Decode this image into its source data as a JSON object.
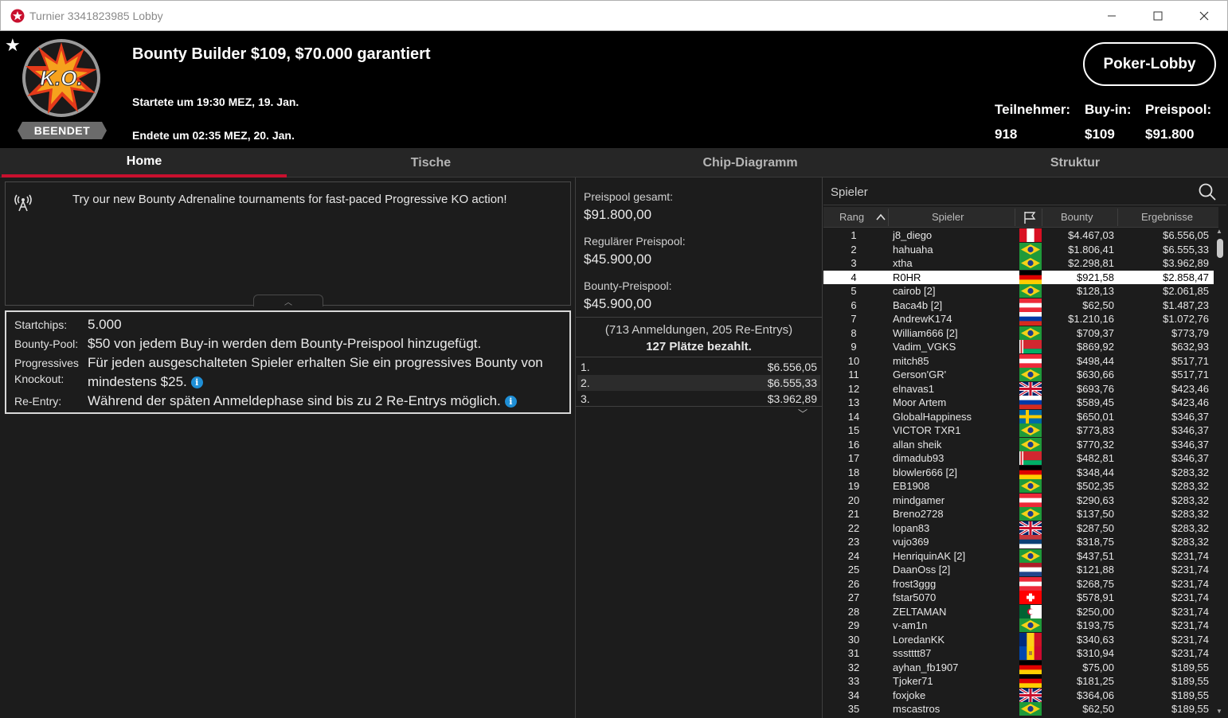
{
  "window": {
    "title": "Turnier 3341823985 Lobby",
    "controls": [
      "minimize-icon",
      "maximize-icon",
      "close-icon"
    ]
  },
  "header": {
    "tournament_name": "Bounty Builder $109, $70.000 garantiert",
    "start": "Startete um 19:30 MEZ, 19. Jan.",
    "end": "Endete um 02:35 MEZ, 20. Jan.",
    "status_badge": "BEENDET",
    "logo_text": "K.O.",
    "lobby_button": "Poker-Lobby",
    "stats": {
      "participants_label": "Teilnehmer:",
      "participants": "918",
      "buyin_label": "Buy-in:",
      "buyin": "$109",
      "prizepool_label": "Preispool:",
      "prizepool": "$91.800"
    }
  },
  "tabs": [
    {
      "label": "Home",
      "active": true
    },
    {
      "label": "Tische",
      "active": false
    },
    {
      "label": "Chip-Diagramm",
      "active": false
    },
    {
      "label": "Struktur",
      "active": false
    }
  ],
  "news": {
    "text": "Try our new Bounty Adrenaline tournaments for fast-paced Progressive KO action!"
  },
  "info": {
    "startchips_label": "Startchips:",
    "startchips": "5.000",
    "bountypool_label": "Bounty-Pool:",
    "bountypool": "$50 von jedem Buy-in werden dem Bounty-Preispool hinzugefügt.",
    "pko_label_1": "Progressives",
    "pko_label_2": "Knockout:",
    "pko_line1": "Für jeden ausgeschalteten Spieler erhalten Sie ein progressives Bounty von",
    "pko_line2": "mindestens $25.",
    "reentry_label": "Re-Entry:",
    "reentry": "Während der späten Anmeldephase sind bis zu 2 Re-Entrys möglich."
  },
  "prize": {
    "total_label": "Preispool gesamt:",
    "total": "$91.800,00",
    "regular_label": "Regulärer Preispool:",
    "regular": "$45.900,00",
    "bounty_label": "Bounty-Preispool:",
    "bounty": "$45.900,00",
    "registrations": "(713 Anmeldungen, 205 Re-Entrys)",
    "paid": "127 Plätze bezahlt.",
    "payouts": [
      {
        "place": "1.",
        "amount": "$6.556,05"
      },
      {
        "place": "2.",
        "amount": "$6.555,33"
      },
      {
        "place": "3.",
        "amount": "$3.962,89"
      }
    ]
  },
  "players": {
    "search_label": "Spieler",
    "columns": {
      "rank": "Rang",
      "player": "Spieler",
      "bounty": "Bounty",
      "result": "Ergebnisse"
    },
    "highlighted_rank": 4,
    "rows": [
      {
        "rank": "1",
        "name": "j8_diego",
        "flag": "pe",
        "bounty": "$4.467,03",
        "result": "$6.556,05"
      },
      {
        "rank": "2",
        "name": "hahuaha",
        "flag": "br",
        "bounty": "$1.806,41",
        "result": "$6.555,33"
      },
      {
        "rank": "3",
        "name": "xtha",
        "flag": "br",
        "bounty": "$2.298,81",
        "result": "$3.962,89"
      },
      {
        "rank": "4",
        "name": "R0HR",
        "flag": "de",
        "bounty": "$921,58",
        "result": "$2.858,47"
      },
      {
        "rank": "5",
        "name": "cairob [2]",
        "flag": "br",
        "bounty": "$128,13",
        "result": "$2.061,85"
      },
      {
        "rank": "6",
        "name": "Baca4b [2]",
        "flag": "at",
        "bounty": "$62,50",
        "result": "$1.487,23"
      },
      {
        "rank": "7",
        "name": "AndrewK174",
        "flag": "ru",
        "bounty": "$1.210,16",
        "result": "$1.072,76"
      },
      {
        "rank": "8",
        "name": "William666 [2]",
        "flag": "br",
        "bounty": "$709,37",
        "result": "$773,79"
      },
      {
        "rank": "9",
        "name": "Vadim_VGKS",
        "flag": "by",
        "bounty": "$869,92",
        "result": "$632,93"
      },
      {
        "rank": "10",
        "name": "mitch85",
        "flag": "at",
        "bounty": "$498,44",
        "result": "$517,71"
      },
      {
        "rank": "11",
        "name": "Gerson'GR'",
        "flag": "br",
        "bounty": "$630,66",
        "result": "$517,71"
      },
      {
        "rank": "12",
        "name": "elnavas1",
        "flag": "gb",
        "bounty": "$693,76",
        "result": "$423,46"
      },
      {
        "rank": "13",
        "name": "Moor Artem",
        "flag": "ru",
        "bounty": "$589,45",
        "result": "$423,46"
      },
      {
        "rank": "14",
        "name": "GlobalHappiness",
        "flag": "se",
        "bounty": "$650,01",
        "result": "$346,37"
      },
      {
        "rank": "15",
        "name": "VICTOR TXR1",
        "flag": "br",
        "bounty": "$773,83",
        "result": "$346,37"
      },
      {
        "rank": "16",
        "name": "allan sheik",
        "flag": "br",
        "bounty": "$770,32",
        "result": "$346,37"
      },
      {
        "rank": "17",
        "name": "dimadub93",
        "flag": "by",
        "bounty": "$482,81",
        "result": "$346,37"
      },
      {
        "rank": "18",
        "name": "blowler666 [2]",
        "flag": "de",
        "bounty": "$348,44",
        "result": "$283,32"
      },
      {
        "rank": "19",
        "name": "EB1908",
        "flag": "br",
        "bounty": "$502,35",
        "result": "$283,32"
      },
      {
        "rank": "20",
        "name": "mindgamer",
        "flag": "at",
        "bounty": "$290,63",
        "result": "$283,32"
      },
      {
        "rank": "21",
        "name": "Breno2728",
        "flag": "br",
        "bounty": "$137,50",
        "result": "$283,32"
      },
      {
        "rank": "22",
        "name": "lopan83",
        "flag": "gb",
        "bounty": "$287,50",
        "result": "$283,32"
      },
      {
        "rank": "23",
        "name": "vujo369",
        "flag": "rs",
        "bounty": "$318,75",
        "result": "$283,32"
      },
      {
        "rank": "24",
        "name": "HenriquinAK [2]",
        "flag": "br",
        "bounty": "$437,51",
        "result": "$231,74"
      },
      {
        "rank": "25",
        "name": "DaanOss [2]",
        "flag": "nl",
        "bounty": "$121,88",
        "result": "$231,74"
      },
      {
        "rank": "26",
        "name": "frost3ggg",
        "flag": "at",
        "bounty": "$268,75",
        "result": "$231,74"
      },
      {
        "rank": "27",
        "name": "fstar5070",
        "flag": "ch",
        "bounty": "$578,91",
        "result": "$231,74"
      },
      {
        "rank": "28",
        "name": "ZELTAMAN",
        "flag": "dz",
        "bounty": "$250,00",
        "result": "$231,74"
      },
      {
        "rank": "29",
        "name": "v-am1n",
        "flag": "br",
        "bounty": "$193,75",
        "result": "$231,74"
      },
      {
        "rank": "30",
        "name": "LoredanKK",
        "flag": "ro",
        "bounty": "$340,63",
        "result": "$231,74"
      },
      {
        "rank": "31",
        "name": "ssstttt87",
        "flag": "md",
        "bounty": "$310,94",
        "result": "$231,74"
      },
      {
        "rank": "32",
        "name": "ayhan_fb1907",
        "flag": "de",
        "bounty": "$75,00",
        "result": "$189,55"
      },
      {
        "rank": "33",
        "name": "Tjoker71",
        "flag": "de",
        "bounty": "$181,25",
        "result": "$189,55"
      },
      {
        "rank": "34",
        "name": "foxjoke",
        "flag": "gb",
        "bounty": "$364,06",
        "result": "$189,55"
      },
      {
        "rank": "35",
        "name": "mscastros",
        "flag": "br",
        "bounty": "$62,50",
        "result": "$189,55"
      }
    ]
  },
  "colors": {
    "accent_red": "#c8102e",
    "info_blue": "#1f8fd6",
    "background": "#1c1c1c",
    "header_bg": "#000000"
  }
}
